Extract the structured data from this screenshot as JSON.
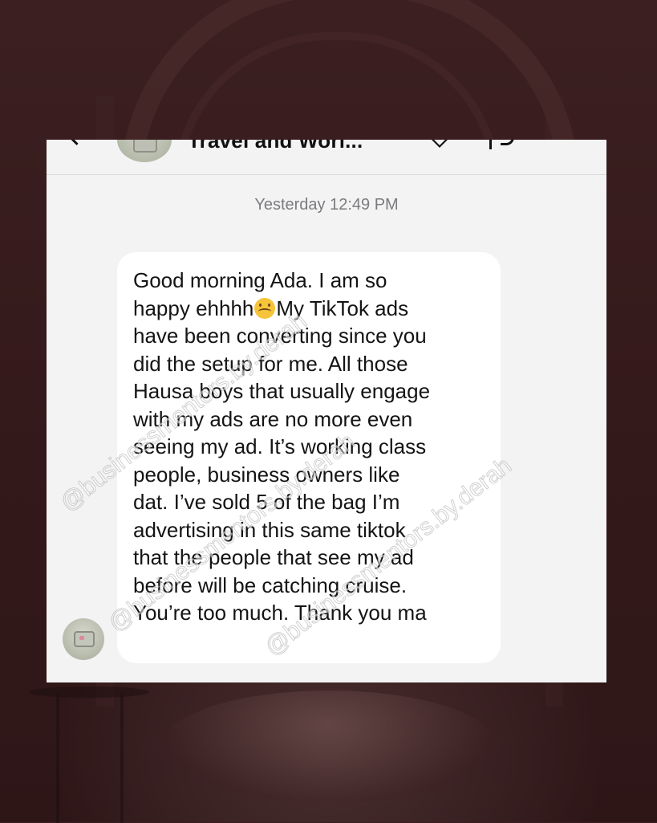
{
  "chat": {
    "header": {
      "contact_name": "Travel and Worl..."
    },
    "timestamp": "Yesterday 12:49 PM",
    "message": {
      "lines": [
        "Good morning Ada. I am so",
        "happy ehhhh",
        "My TikTok ads",
        "have been converting since you",
        "did the setup for me. All those",
        "Hausa boys that usually engage",
        "with my ads are no more even",
        "seeing my ad. It’s  working class",
        "people, business owners like",
        "dat. I’ve sold 5 of the bag I’m",
        "advertising in this same tiktok",
        "that the people that see my ad",
        "before will be catching cruise.",
        "You’re too much. Thank you ma"
      ],
      "emoji": "upside-down-face-emoji"
    }
  },
  "watermarks": {
    "w1": "@businessmentors.by.derah",
    "w2": "@businessmentors.by.derah",
    "w3": "@businessmentors.by.derah"
  },
  "colors": {
    "page_background": "#3a1e1f",
    "card_background": "#f3f3f4",
    "bubble_background": "#ffffff",
    "timestamp_text": "#7b7b80"
  }
}
